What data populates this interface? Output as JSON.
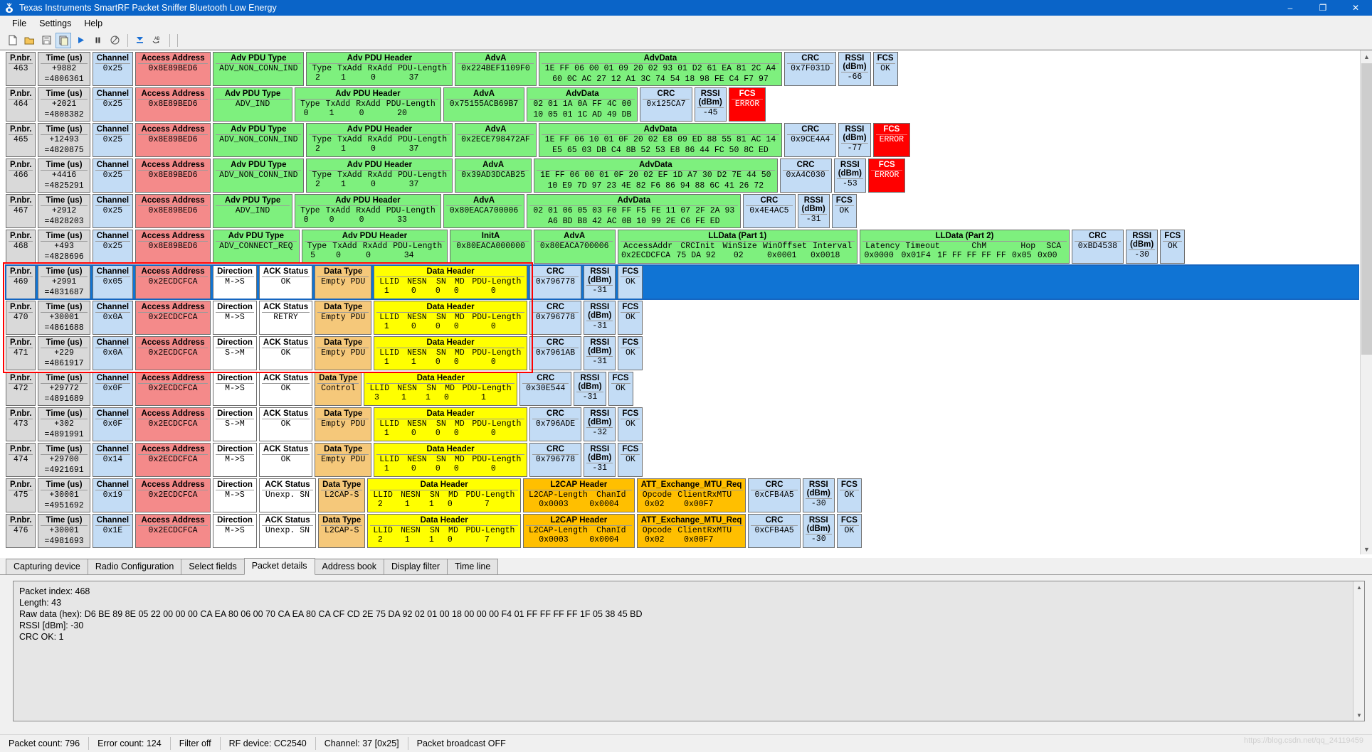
{
  "window": {
    "title": "Texas Instruments SmartRF Packet Sniffer Bluetooth Low Energy",
    "minimize": "–",
    "maximize": "❐",
    "close": "✕"
  },
  "menu": {
    "items": [
      "File",
      "Settings",
      "Help"
    ]
  },
  "toolbar": {
    "buttons": [
      {
        "name": "new-icon",
        "glyph": "὜B"
      },
      {
        "name": "open-icon",
        "glyph": "folder"
      },
      {
        "name": "save-icon",
        "glyph": "save"
      },
      {
        "name": "save-as-icon",
        "glyph": "copy"
      },
      {
        "name": "start-icon",
        "glyph": "▶"
      },
      {
        "name": "pause-icon",
        "glyph": "‖"
      },
      {
        "name": "clear-icon",
        "glyph": "clear"
      },
      {
        "name": "scroll-to-end-icon",
        "glyph": "▼"
      },
      {
        "name": "find-icon",
        "glyph": "AB"
      }
    ]
  },
  "columns": {
    "pnbr": "P.nbr.",
    "time": "Time (us)",
    "channel": "Channel",
    "access_address": "Access Address",
    "adv_pdu_type": "Adv PDU Type",
    "adv_pdu_header": "Adv PDU Header",
    "adv_sub": [
      "Type",
      "TxAdd",
      "RxAdd",
      "PDU-Length"
    ],
    "adva": "AdvA",
    "inita": "InitA",
    "advdata": "AdvData",
    "crc": "CRC",
    "rssi": "RSSI (dBm)",
    "fcs": "FCS",
    "direction": "Direction",
    "ack_status": "ACK Status",
    "data_type": "Data Type",
    "data_header": "Data Header",
    "data_sub": [
      "LLID",
      "NESN",
      "SN",
      "MD",
      "PDU-Length"
    ],
    "lldata1": "LLData (Part 1)",
    "lldata1_sub": [
      "AccessAddr",
      "CRCInit",
      "WinSize",
      "WinOffset",
      "Interval"
    ],
    "lldata2": "LLData (Part 2)",
    "lldata2_sub": [
      "Latency",
      "Timeout",
      "ChM",
      "Hop",
      "SCA"
    ],
    "l2cap_header": "L2CAP Header",
    "l2cap_sub": [
      "L2CAP-Length",
      "ChanId"
    ],
    "att_req": "ATT_Exchange_MTU_Req",
    "att_sub": [
      "Opcode",
      "ClientRxMTU"
    ]
  },
  "packets": [
    {
      "kind": "adv",
      "pnbr": "463",
      "t_delta": "+9882",
      "t_abs": "=4806361",
      "channel": "0x25",
      "access_address": "0x8E89BED6",
      "pdu_type": "ADV_NON_CONN_IND",
      "hdr": [
        "2",
        "1",
        "0",
        "37"
      ],
      "adva": "0x224BEF1109F0",
      "advdata1": "1E FF 06 00 01 09 20 02 93 01 D2 61 EA 81 2C A4",
      "advdata2": "60 0C AC 27 12 A1 3C 74 54 18 98 FE C4 F7 97",
      "crc": "0x7F031D",
      "rssi": "-66",
      "fcs": "OK",
      "fcs_error": false
    },
    {
      "kind": "adv",
      "pnbr": "464",
      "t_delta": "+2021",
      "t_abs": "=4808382",
      "channel": "0x25",
      "access_address": "0x8E89BED6",
      "pdu_type": "ADV_IND",
      "hdr": [
        "0",
        "1",
        "0",
        "20"
      ],
      "adva": "0x75155ACB69B7",
      "advdata1": "02 01 1A 0A FF 4C 00",
      "advdata2": "10 05 01 1C AD 49 DB",
      "crc": "0x125CA7",
      "rssi": "-45",
      "fcs": "ERROR",
      "fcs_error": true
    },
    {
      "kind": "adv",
      "pnbr": "465",
      "t_delta": "+12493",
      "t_abs": "=4820875",
      "channel": "0x25",
      "access_address": "0x8E89BED6",
      "pdu_type": "ADV_NON_CONN_IND",
      "hdr": [
        "2",
        "1",
        "0",
        "37"
      ],
      "adva": "0x2ECE798472AF",
      "advdata1": "1E FF 06 10 01 0F 20 02 E8 09 ED 88 55 81 AC 14",
      "advdata2": "E5 65 03 DB C4 8B 52 53 E8 86 44 FC 50 8C ED",
      "crc": "0x9CE4A4",
      "rssi": "-77",
      "fcs": "ERROR",
      "fcs_error": true
    },
    {
      "kind": "adv",
      "pnbr": "466",
      "t_delta": "+4416",
      "t_abs": "=4825291",
      "channel": "0x25",
      "access_address": "0x8E89BED6",
      "pdu_type": "ADV_NON_CONN_IND",
      "hdr": [
        "2",
        "1",
        "0",
        "37"
      ],
      "adva": "0x39AD3DCAB25",
      "advdata1": "1E FF 06 00 01 0F 20 02 EF 1D A7 30 D2 7E 44 50",
      "advdata2": "10 E9 7D 97 23 4E 82 F6 86 94 88 6C 41 26 72",
      "crc": "0xA4C030",
      "rssi": "-53",
      "fcs": "ERROR",
      "fcs_error": true
    },
    {
      "kind": "adv",
      "pnbr": "467",
      "t_delta": "+2912",
      "t_abs": "=4828203",
      "channel": "0x25",
      "access_address": "0x8E89BED6",
      "pdu_type": "ADV_IND",
      "hdr": [
        "0",
        "0",
        "0",
        "33"
      ],
      "adva": "0x80EACA700006",
      "advdata1": "02 01 06 05 03 F0 FF F5 FE 11 07 2F 2A 93",
      "advdata2": "A6 BD B8 42 AC 0B 10 99 2E C6 FE ED",
      "crc": "0x4E4AC5",
      "rssi": "-31",
      "fcs": "OK",
      "fcs_error": false
    },
    {
      "kind": "connreq",
      "pnbr": "468",
      "t_delta": "+493",
      "t_abs": "=4828696",
      "channel": "0x25",
      "access_address": "0x8E89BED6",
      "pdu_type": "ADV_CONNECT_REQ",
      "hdr": [
        "5",
        "0",
        "0",
        "34"
      ],
      "inita": "0x80EACA000000",
      "adva": "0x80EACA700006",
      "lldata1": [
        "0x2ECDCFCA",
        "75 DA 92",
        "02",
        "0x0001",
        "0x0018"
      ],
      "lldata2": [
        "0x0000",
        "0x01F4",
        "1F FF FF FF FF",
        "0x05",
        "0x00"
      ],
      "crc": "0xBD4538",
      "rssi": "-30",
      "fcs": "OK",
      "fcs_error": false
    },
    {
      "kind": "data",
      "selected": true,
      "pnbr": "469",
      "t_delta": "+2991",
      "t_abs": "=4831687",
      "channel": "0x05",
      "access_address": "0x2ECDCFCA",
      "direction": "M->S",
      "ack": "OK",
      "data_type": "Empty PDU",
      "dh": [
        "1",
        "0",
        "0",
        "0",
        "0"
      ],
      "crc": "0x796778",
      "rssi": "-31",
      "fcs": "OK",
      "fcs_error": false
    },
    {
      "kind": "data",
      "pnbr": "470",
      "t_delta": "+30001",
      "t_abs": "=4861688",
      "channel": "0x0A",
      "access_address": "0x2ECDCFCA",
      "direction": "M->S",
      "ack": "RETRY",
      "data_type": "Empty PDU",
      "dh": [
        "1",
        "0",
        "0",
        "0",
        "0"
      ],
      "crc": "0x796778",
      "rssi": "-31",
      "fcs": "OK",
      "fcs_error": false
    },
    {
      "kind": "data",
      "pnbr": "471",
      "t_delta": "+229",
      "t_abs": "=4861917",
      "channel": "0x0A",
      "access_address": "0x2ECDCFCA",
      "direction": "S->M",
      "ack": "OK",
      "data_type": "Empty PDU",
      "dh": [
        "1",
        "1",
        "0",
        "0",
        "0"
      ],
      "crc": "0x7961AB",
      "rssi": "-31",
      "fcs": "OK",
      "fcs_error": false
    },
    {
      "kind": "data",
      "pnbr": "472",
      "t_delta": "+29772",
      "t_abs": "=4891689",
      "channel": "0x0F",
      "access_address": "0x2ECDCFCA",
      "direction": "M->S",
      "ack": "OK",
      "data_type": "Control",
      "dh": [
        "3",
        "1",
        "1",
        "0",
        "1"
      ],
      "crc": "0x30E544",
      "rssi": "-31",
      "fcs": "OK",
      "fcs_error": false
    },
    {
      "kind": "data",
      "pnbr": "473",
      "t_delta": "+302",
      "t_abs": "=4891991",
      "channel": "0x0F",
      "access_address": "0x2ECDCFCA",
      "direction": "S->M",
      "ack": "OK",
      "data_type": "Empty PDU",
      "dh": [
        "1",
        "0",
        "0",
        "0",
        "0"
      ],
      "crc": "0x796ADE",
      "rssi": "-32",
      "fcs": "OK",
      "fcs_error": false
    },
    {
      "kind": "data",
      "pnbr": "474",
      "t_delta": "+29700",
      "t_abs": "=4921691",
      "channel": "0x14",
      "access_address": "0x2ECDCFCA",
      "direction": "M->S",
      "ack": "OK",
      "data_type": "Empty PDU",
      "dh": [
        "1",
        "0",
        "0",
        "0",
        "0"
      ],
      "crc": "0x796778",
      "rssi": "-31",
      "fcs": "OK",
      "fcs_error": false
    },
    {
      "kind": "l2cap",
      "pnbr": "475",
      "t_delta": "+30001",
      "t_abs": "=4951692",
      "channel": "0x19",
      "access_address": "0x2ECDCFCA",
      "direction": "M->S",
      "ack": "Unexp. SN",
      "data_type": "L2CAP-S",
      "dh": [
        "2",
        "1",
        "1",
        "0",
        "7"
      ],
      "l2cap": [
        "0x0003",
        "0x0004"
      ],
      "att": [
        "0x02",
        "0x00F7"
      ],
      "crc": "0xCFB4A5",
      "rssi": "-30",
      "fcs": "OK",
      "fcs_error": false
    },
    {
      "kind": "l2cap",
      "partial": true,
      "pnbr": "476",
      "t_delta": "+30001",
      "t_abs": "=4981693",
      "channel": "0x1E",
      "access_address": "0x2ECDCFCA",
      "direction": "M->S",
      "ack": "Unexp. SN",
      "data_type": "L2CAP-S",
      "dh": [
        "2",
        "1",
        "1",
        "0",
        "7"
      ],
      "l2cap": [
        "0x0003",
        "0x0004"
      ],
      "att": [
        "0x02",
        "0x00F7"
      ],
      "crc": "0xCFB4A5",
      "rssi": "-30",
      "fcs": "OK",
      "fcs_error": false
    }
  ],
  "bottom_tabs": [
    "Capturing device",
    "Radio Configuration",
    "Select fields",
    "Packet details",
    "Address book",
    "Display filter",
    "Time line"
  ],
  "active_tab": "Packet details",
  "packet_details": "Packet index: 468\nLength: 43\nRaw data (hex): D6 BE 89 8E 05 22 00 00 00 CA EA 80 06 00 70 CA EA 80 CA CF CD 2E 75 DA 92 02 01 00 18 00 00 00 F4 01 FF FF FF FF 1F 05 38 45 BD\nRSSI [dBm]: -30\nCRC OK: 1",
  "statusbar": {
    "packet_count": "Packet count: 796",
    "error_count": "Error count: 124",
    "filter": "Filter off",
    "rf_device": "RF device: CC2540",
    "channel": "Channel: 37 [0x25]",
    "broadcast": "Packet broadcast OFF"
  },
  "watermark": "https://blog.csdn.net/qq_24119459"
}
